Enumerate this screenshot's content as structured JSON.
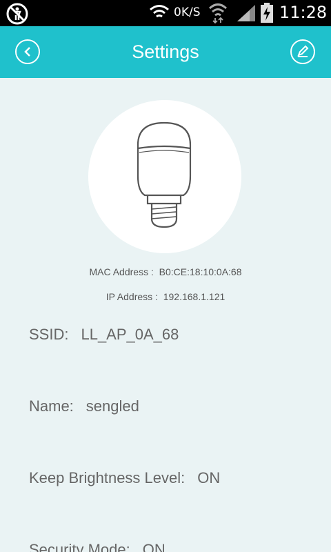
{
  "status_bar": {
    "net_speed": "0K/S",
    "time": "11:28",
    "icons": [
      "accessibility-icon",
      "wifi-icon",
      "wifi-data-icon",
      "cell-signal-icon",
      "battery-charging-icon"
    ]
  },
  "header": {
    "title": "Settings",
    "back_icon": "chevron-left-circle-icon",
    "edit_icon": "pencil-circle-icon",
    "color": "#1fc1cc"
  },
  "device": {
    "image": "light-bulb-icon",
    "mac_label": "MAC Address :",
    "mac_value": "B0:CE:18:10:0A:68",
    "ip_label": "IP Address :",
    "ip_value": "192.168.1.121"
  },
  "fields": {
    "ssid": {
      "label": "SSID:",
      "value": "LL_AP_0A_68"
    },
    "name": {
      "label": "Name:",
      "value": "sengled"
    },
    "keep_brightness": {
      "label": "Keep Brightness Level:",
      "value": "ON"
    },
    "security_mode": {
      "label": "Security Mode:",
      "value": "ON"
    }
  }
}
